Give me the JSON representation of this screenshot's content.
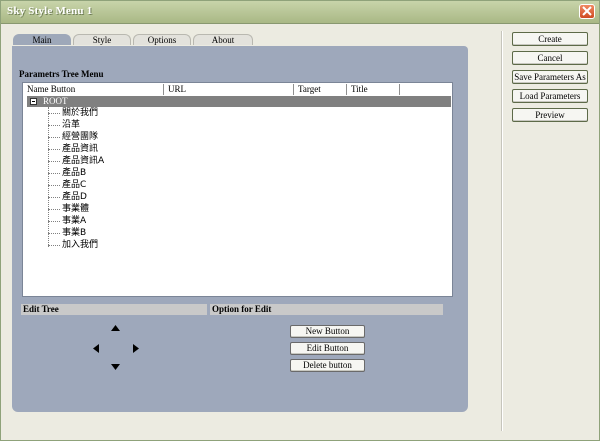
{
  "window": {
    "title": "Sky Style Menu 1"
  },
  "tabs": [
    {
      "label": "Main",
      "active": true
    },
    {
      "label": "Style",
      "active": false
    },
    {
      "label": "Options",
      "active": false
    },
    {
      "label": "About",
      "active": false
    }
  ],
  "tree": {
    "title": "Parametrs Tree Menu",
    "columns": [
      "Name Button",
      "URL",
      "Target",
      "Title"
    ],
    "root": "ROOT",
    "items": [
      "關於我們",
      "沿革",
      "經營團隊",
      "產品資訊",
      "產品資訊A",
      "產品B",
      "產品C",
      "產品D",
      "事業體",
      "事業A",
      "事業B",
      "加入我們"
    ]
  },
  "edit_tree": {
    "title": "Edit Tree"
  },
  "option_for_edit": {
    "title": "Option for Edit",
    "buttons": [
      "New Button",
      "Edit Button",
      "Delete button"
    ]
  },
  "side_buttons": [
    "Create",
    "Cancel",
    "Save Parameters As",
    "Load Parameters",
    "Preview"
  ],
  "colors": {
    "panel": "#9ea8bb",
    "titlebar": "#b7c497",
    "close": "#d9592e",
    "root_row": "#808080"
  }
}
